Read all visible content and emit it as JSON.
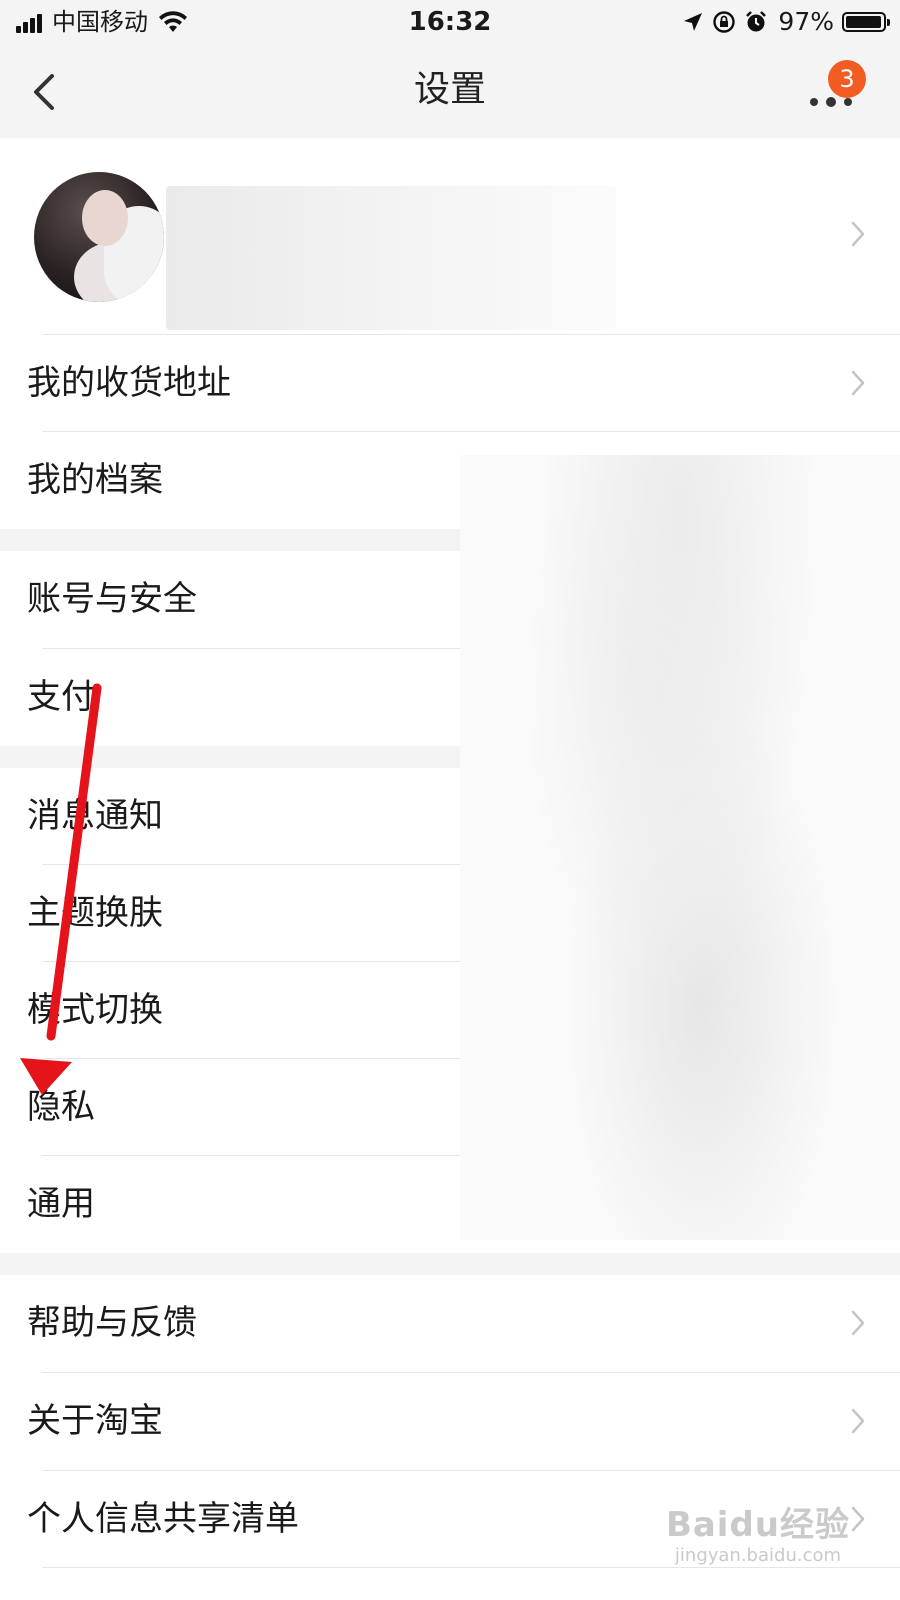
{
  "status_bar": {
    "carrier": "中国移动",
    "time": "16:32",
    "battery": "97%",
    "battery_level": 0.97,
    "signal_icon": "signal-icon",
    "wifi_icon": "wifi-icon",
    "location_icon": "location-arrow-icon",
    "rotation_lock_icon": "rotation-lock-icon",
    "alarm_icon": "alarm-icon"
  },
  "nav": {
    "title": "设置",
    "back_icon": "chevron-left-icon",
    "more_icon": "more-dots-icon",
    "badge_count": "3",
    "badge_color": "#f25b22"
  },
  "profile": {
    "avatar": "avatar",
    "chevron_icon": "chevron-right-icon"
  },
  "menu": {
    "address": "我的收货地址",
    "archive": "我的档案",
    "account_security": "账号与安全",
    "payment": "支付",
    "notifications": "消息通知",
    "themes": "主题换肤",
    "mode_switch": "模式切换",
    "privacy": "隐私",
    "general": "通用",
    "help_feedback": "帮助与反馈",
    "about": "关于淘宝",
    "personal_info_list": "个人信息共享清单"
  },
  "annotation": {
    "arrow_color": "#e5131a"
  },
  "watermark": {
    "brand": "Baidu经验",
    "url": "jingyan.baidu.com"
  },
  "colors": {
    "background": "#ffffff",
    "section_gap": "#f4f4f4",
    "divider": "#e6e6e6",
    "text": "#1a1a1a",
    "chevron": "#c4c4c4"
  }
}
